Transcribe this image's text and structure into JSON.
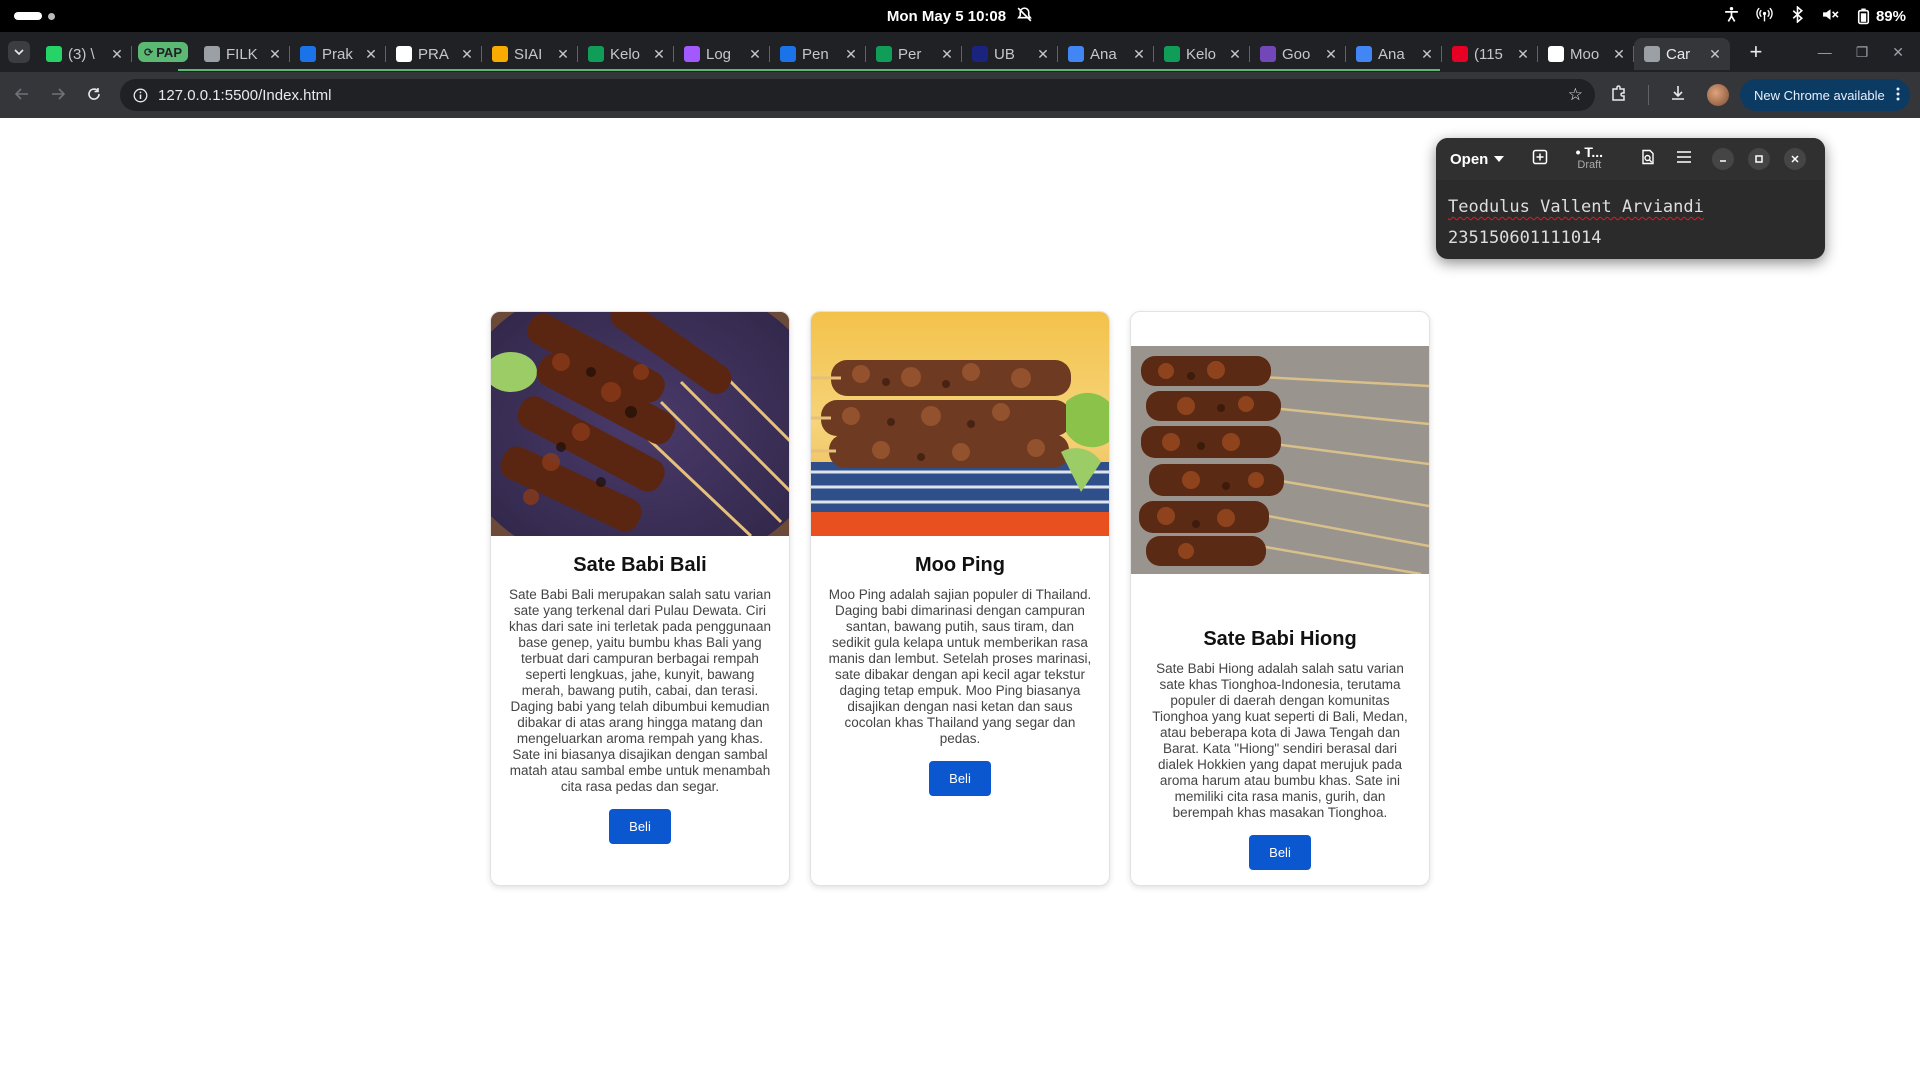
{
  "system_bar": {
    "clock": "Mon May 5  10:08",
    "battery": "89%"
  },
  "browser": {
    "tabs": [
      {
        "title": "(3) \\",
        "favicon": "whatsapp-icon",
        "color": "#25d366"
      },
      {
        "title": "FILK",
        "favicon": "link-icon",
        "color": "#9aa0a6"
      },
      {
        "title": "Prak",
        "favicon": "classroom-icon",
        "color": "#1a73e8"
      },
      {
        "title": "PRA",
        "favicon": "github-icon",
        "color": "#ffffff"
      },
      {
        "title": "SIAI",
        "favicon": "siam-icon",
        "color": "#f9ab00"
      },
      {
        "title": "Kelo",
        "favicon": "sheets-icon",
        "color": "#0f9d58"
      },
      {
        "title": "Log",
        "favicon": "figma-icon",
        "color": "#a259ff"
      },
      {
        "title": "Pen",
        "favicon": "classroom-icon",
        "color": "#1a73e8"
      },
      {
        "title": "Per",
        "favicon": "sheets-icon",
        "color": "#0f9d58"
      },
      {
        "title": "UB",
        "favicon": "ub-icon",
        "color": "#1a237e"
      },
      {
        "title": "Ana",
        "favicon": "docs-icon",
        "color": "#4285f4"
      },
      {
        "title": "Kelo",
        "favicon": "sheets-icon",
        "color": "#0f9d58"
      },
      {
        "title": "Goo",
        "favicon": "forms-icon",
        "color": "#7248b9"
      },
      {
        "title": "Ana",
        "favicon": "docs-icon",
        "color": "#4285f4"
      },
      {
        "title": "(115",
        "favicon": "pinterest-icon",
        "color": "#e60023"
      },
      {
        "title": "Moo",
        "favicon": "google-icon",
        "color": "#ffffff"
      },
      {
        "title": "Car",
        "favicon": "globe-icon",
        "color": "#9aa0a6",
        "active": true
      }
    ],
    "tab_group_label": "PAP",
    "url": "127.0.0.1:5500/Index.html",
    "update_label": "New Chrome available"
  },
  "editor": {
    "open_label": "Open",
    "title": "• T...",
    "subtitle": "Draft",
    "line1": "Teodulus Vallent Arviandi",
    "line2": "235150601111014"
  },
  "cards": [
    {
      "title": "Sate Babi Bali",
      "description": "Sate Babi Bali merupakan salah satu varian sate yang terkenal dari Pulau Dewata. Ciri khas dari sate ini terletak pada penggunaan base genep, yaitu bumbu khas Bali yang terbuat dari campuran berbagai rempah seperti lengkuas, jahe, kunyit, bawang merah, bawang putih, cabai, dan terasi. Daging babi yang telah dibumbui kemudian dibakar di atas arang hingga matang dan mengeluarkan aroma rempah yang khas. Sate ini biasanya disajikan dengan sambal matah atau sambal embe untuk menambah cita rasa pedas dan segar.",
      "button": "Beli"
    },
    {
      "title": "Moo Ping",
      "description": "Moo Ping adalah sajian populer di Thailand. Daging babi dimarinasi dengan campuran santan, bawang putih, saus tiram, dan sedikit gula kelapa untuk memberikan rasa manis dan lembut. Setelah proses marinasi, sate dibakar dengan api kecil agar tekstur daging tetap empuk. Moo Ping biasanya disajikan dengan nasi ketan dan saus cocolan khas Thailand yang segar dan pedas.",
      "button": "Beli"
    },
    {
      "title": "Sate Babi Hiong",
      "description": "Sate Babi Hiong adalah salah satu varian sate khas Tionghoa-Indonesia, terutama populer di daerah dengan komunitas Tionghoa yang kuat seperti di Bali, Medan, atau beberapa kota di Jawa Tengah dan Barat. Kata \"Hiong\" sendiri berasal dari dialek Hokkien yang dapat merujuk pada aroma harum atau bumbu khas. Sate ini memiliki cita rasa manis, gurih, dan berempah khas masakan Tionghoa.",
      "button": "Beli"
    }
  ]
}
